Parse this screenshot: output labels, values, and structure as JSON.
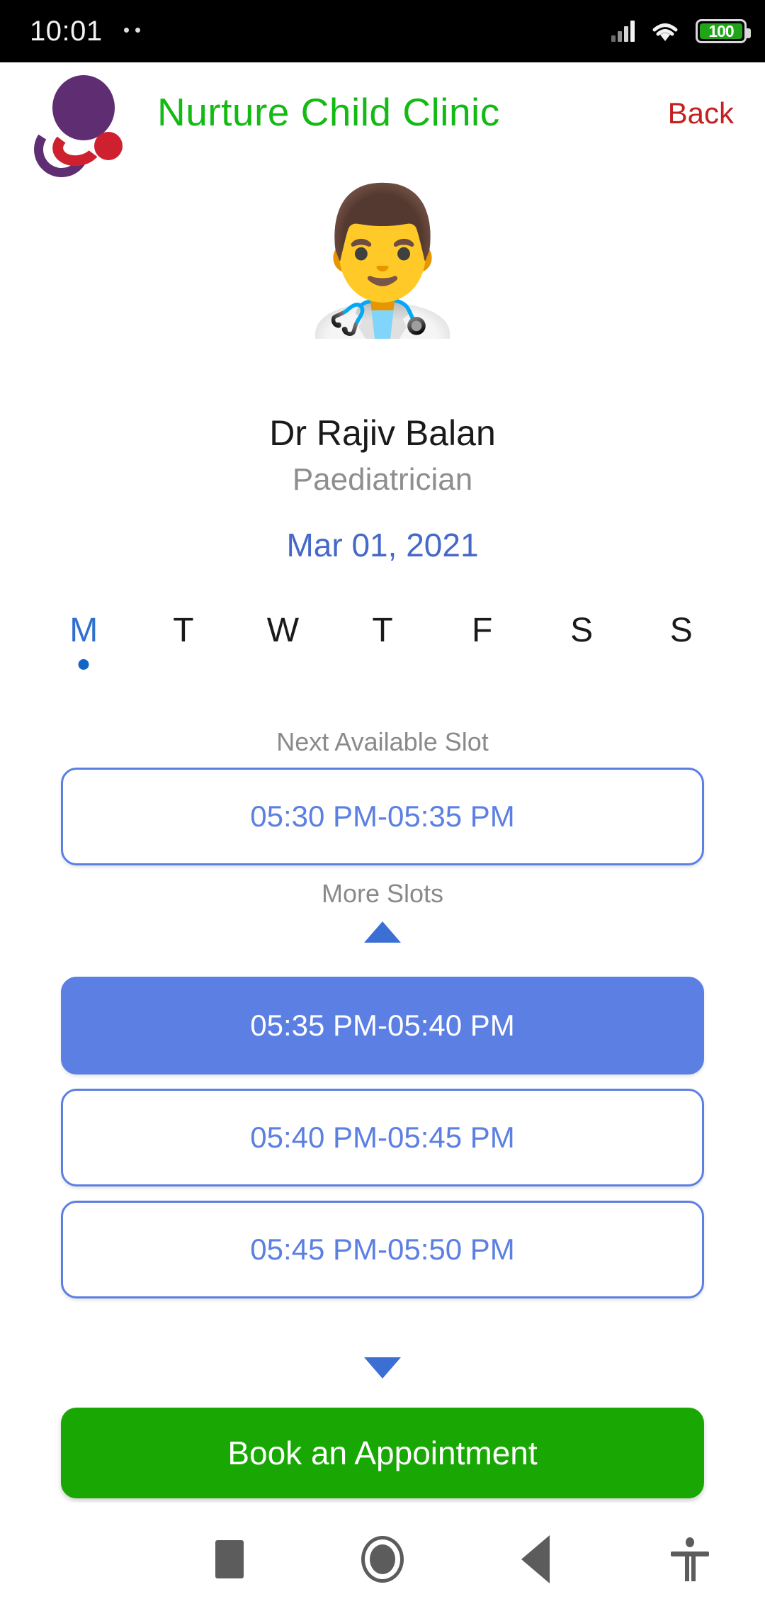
{
  "status_bar": {
    "time": "10:01",
    "battery_level": "100",
    "signal_icon": "signal-bars-icon",
    "wifi_icon": "wifi-icon",
    "battery_icon": "battery-icon",
    "battery_color": "#21a518"
  },
  "header": {
    "clinic_name": "Nurture Child Clinic",
    "clinic_name_color": "#13ba13",
    "back_label": "Back",
    "back_color": "#c42020",
    "logo_icon": "clinic-logo-icon",
    "logo_colors": {
      "purple": "#5f2d72",
      "red": "#cf2030"
    }
  },
  "doctor": {
    "avatar_icon": "doctor-avatar-icon",
    "avatar_glyph": "👨‍⚕️",
    "name": "Dr Rajiv Balan",
    "speciality": "Paediatrician",
    "date": "Mar 01, 2021",
    "date_color": "#4668c8"
  },
  "week": {
    "active_index": 0,
    "days": [
      {
        "label": "M",
        "selected": true
      },
      {
        "label": "T",
        "selected": false
      },
      {
        "label": "W",
        "selected": false
      },
      {
        "label": "T",
        "selected": false
      },
      {
        "label": "F",
        "selected": false
      },
      {
        "label": "S",
        "selected": false
      },
      {
        "label": "S",
        "selected": false
      }
    ]
  },
  "slots": {
    "next_label": "Next Available Slot",
    "next_slot": "05:30 PM-05:35 PM",
    "more_label": "More Slots",
    "collapse_icon": "chevron-up-icon",
    "expand_icon": "chevron-down-icon",
    "accent_color": "#5b7fe3",
    "list": [
      {
        "time": "05:35 PM-05:40 PM",
        "selected": true
      },
      {
        "time": "05:40 PM-05:45 PM",
        "selected": false
      },
      {
        "time": "05:45 PM-05:50 PM",
        "selected": false
      },
      {
        "time": "",
        "selected": false
      }
    ]
  },
  "actions": {
    "book_label": "Book an Appointment",
    "book_color": "#19a803"
  },
  "navbar": {
    "recents_icon": "recents-square-icon",
    "home_icon": "home-circle-icon",
    "back_icon": "back-triangle-icon",
    "accessibility_icon": "accessibility-icon"
  }
}
